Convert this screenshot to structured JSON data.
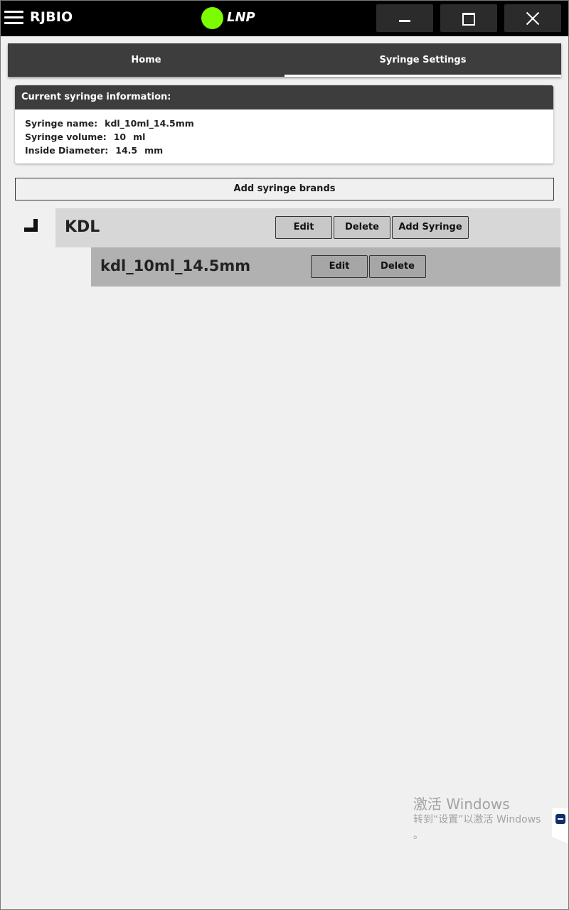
{
  "titlebar": {
    "brand": "RJBIO",
    "status_text": "LNP",
    "status_color": "#7cfc00"
  },
  "tabs": [
    {
      "label": "Home",
      "active": false
    },
    {
      "label": "Syringe Settings",
      "active": true
    }
  ],
  "current_info": {
    "title": "Current syringe information:",
    "name_label": "Syringe name:",
    "name_value": "kdl_10ml_14.5mm",
    "volume_label": "Syringe volume:",
    "volume_value": "10",
    "volume_unit": "ml",
    "diameter_label": "Inside Diameter:",
    "diameter_value": "14.5",
    "diameter_unit": "mm"
  },
  "add_brand_label": "Add syringe brands",
  "brands": [
    {
      "name": "KDL",
      "edit_label": "Edit",
      "delete_label": "Delete",
      "add_label": "Add Syringe",
      "syringes": [
        {
          "name": "kdl_10ml_14.5mm",
          "edit_label": "Edit",
          "delete_label": "Delete"
        }
      ]
    }
  ],
  "watermark": {
    "title": "激活 Windows",
    "subtitle": "转到“设置”以激活 Windows",
    "trail": "。"
  },
  "icons": {
    "menu": "hamburger-menu-icon",
    "minimize": "minimize-icon",
    "maximize": "maximize-icon",
    "close": "close-icon",
    "collapse": "collapse-icon",
    "remote": "teamviewer-icon"
  }
}
